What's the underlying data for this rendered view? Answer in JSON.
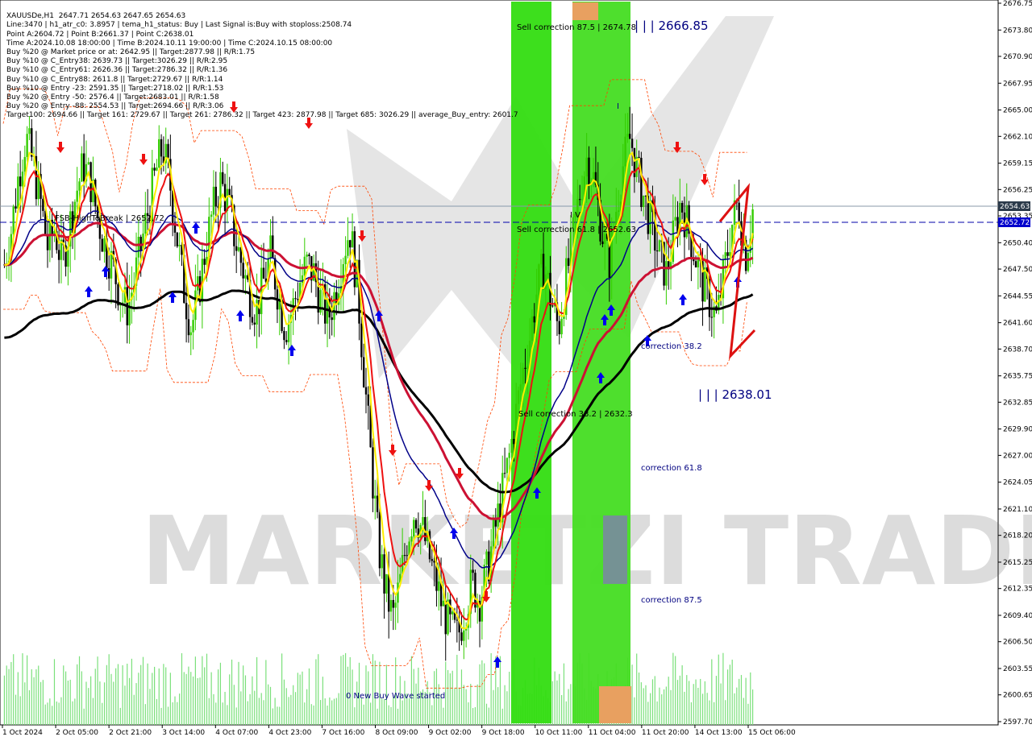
{
  "header": {
    "symbol_line": "XAUUSDe,H1  2647.71 2654.63 2647.65 2654.63",
    "lines": [
      "Line:3470 | h1_atr_c0: 3.8957 | tema_h1_status: Buy | Last Signal is:Buy with stoploss:2508.74",
      "Point A:2604.72 | Point B:2661.37 | Point C:2638.01",
      "Time A:2024.10.08 18:00:00 | Time B:2024.10.11 19:00:00 | Time C:2024.10.15 08:00:00",
      "Buy %20 @ Market price or at: 2642.95 || Target:2877.98 || R/R:1.75",
      "Buy %10 @ C_Entry38: 2639.73 || Target:3026.29 || R/R:2.95",
      "Buy %10 @ C_Entry61: 2626.36 || Target:2786.32 || R/R:1.36",
      "Buy %10 @ C_Entry88: 2611.8 || Target:2729.67 || R/R:1.14",
      "Buy %10 @ Entry -23: 2591.35 || Target:2718.02 || R/R:1.53",
      "Buy %20 @ Entry -50: 2576.4 || Target:2683.01 || R/R:1.58",
      "Buy %20 @ Entry -88: 2554.53 || Target:2694.66 || R/R:3.06",
      "Target100: 2694.66 || Target 161: 2729.67 || Target 261: 2786.32 || Target 423: 2877.98 || Target 685: 3026.29 || average_Buy_entry: 2601.7"
    ]
  },
  "annotations": {
    "fsb": "FSB-HighToBreak | 2652.72",
    "sell_875": "Sell correction 87.5 | 2674.78",
    "sell_618": "Sell correction 61.8 | 2652.63",
    "sell_382": "Sell correction 38.2 | 2632.3",
    "top_level": "| | | 2666.85",
    "low_level": "| | | 2638.01",
    "corr_382": "correction 38.2",
    "corr_618": "correction 61.8",
    "corr_875": "correction 87.5",
    "new_wave": "0 New Buy Wave started",
    "iv_mark": "I V",
    "i_mark": "I",
    "watermark": "MARKETZI TRADE"
  },
  "price_tags": {
    "current": "2654.63",
    "fsb": "2652.72"
  },
  "colors": {
    "bull_green": "#33cc00",
    "bear_red": "#dd0000",
    "sell_zone": "#55dd22",
    "accent_orange": "#e8a060",
    "ma_black": "#000000",
    "ma_crimson": "#cc1133",
    "ma_navy": "#000088",
    "ma_red": "#ee1111",
    "ma_yellow": "#ffee00",
    "fsb_line": "#0000aa"
  },
  "chart_data": {
    "type": "candlestick",
    "symbol": "XAUUSDe",
    "timeframe": "H1",
    "ylim": [
      2597.7,
      2676.75
    ],
    "y_ticks": [
      "2676.75",
      "2673.80",
      "2670.90",
      "2667.95",
      "2665.00",
      "2662.10",
      "2659.15",
      "2656.25",
      "2653.35",
      "2650.40",
      "2647.50",
      "2644.55",
      "2641.60",
      "2638.70",
      "2635.75",
      "2632.85",
      "2629.90",
      "2627.00",
      "2624.05",
      "2621.10",
      "2618.20",
      "2615.25",
      "2612.35",
      "2609.40",
      "2606.50",
      "2603.55",
      "2600.65",
      "2597.70"
    ],
    "x_ticks": [
      "1 Oct 2024",
      "2 Oct 05:00",
      "2 Oct 21:00",
      "3 Oct 14:00",
      "4 Oct 07:00",
      "4 Oct 23:00",
      "7 Oct 16:00",
      "8 Oct 09:00",
      "9 Oct 02:00",
      "9 Oct 18:00",
      "10 Oct 11:00",
      "11 Oct 04:00",
      "11 Oct 20:00",
      "14 Oct 13:00",
      "15 Oct 06:00"
    ],
    "close_path": [
      2648,
      2652,
      2658,
      2662,
      2659,
      2655,
      2650,
      2652,
      2648,
      2652,
      2656,
      2659,
      2657,
      2653,
      2650,
      2648,
      2645,
      2643,
      2646,
      2650,
      2654,
      2658,
      2661,
      2657,
      2651,
      2645,
      2641,
      2645,
      2650,
      2654,
      2657,
      2655,
      2651,
      2648,
      2645,
      2643,
      2646,
      2649,
      2645,
      2641,
      2643,
      2646,
      2648,
      2647,
      2644,
      2642,
      2645,
      2649,
      2652,
      2646,
      2636,
      2626,
      2617,
      2612,
      2609,
      2613,
      2618,
      2621,
      2619,
      2616,
      2613,
      2610,
      2608,
      2607,
      2610,
      2613,
      2611,
      2614,
      2618,
      2622,
      2626,
      2631,
      2636,
      2640,
      2645,
      2648,
      2644,
      2641,
      2646,
      2651,
      2656,
      2660,
      2657,
      2652,
      2648,
      2654,
      2659,
      2662,
      2658,
      2655,
      2652,
      2649,
      2647,
      2651,
      2655,
      2652,
      2649,
      2646,
      2644,
      2642,
      2647,
      2652,
      2655,
      2649,
      2654
    ],
    "highlights": [
      {
        "name": "Sell correction 87.5 zone",
        "value": 2674.78
      },
      {
        "name": "Sell correction 61.8",
        "value": 2652.63
      },
      {
        "name": "Sell correction 38.2",
        "value": 2632.3
      },
      {
        "name": "FSB-HighToBreak",
        "value": 2652.72
      },
      {
        "name": "Top level",
        "value": 2666.85
      },
      {
        "name": "Low level",
        "value": 2638.01
      }
    ]
  }
}
